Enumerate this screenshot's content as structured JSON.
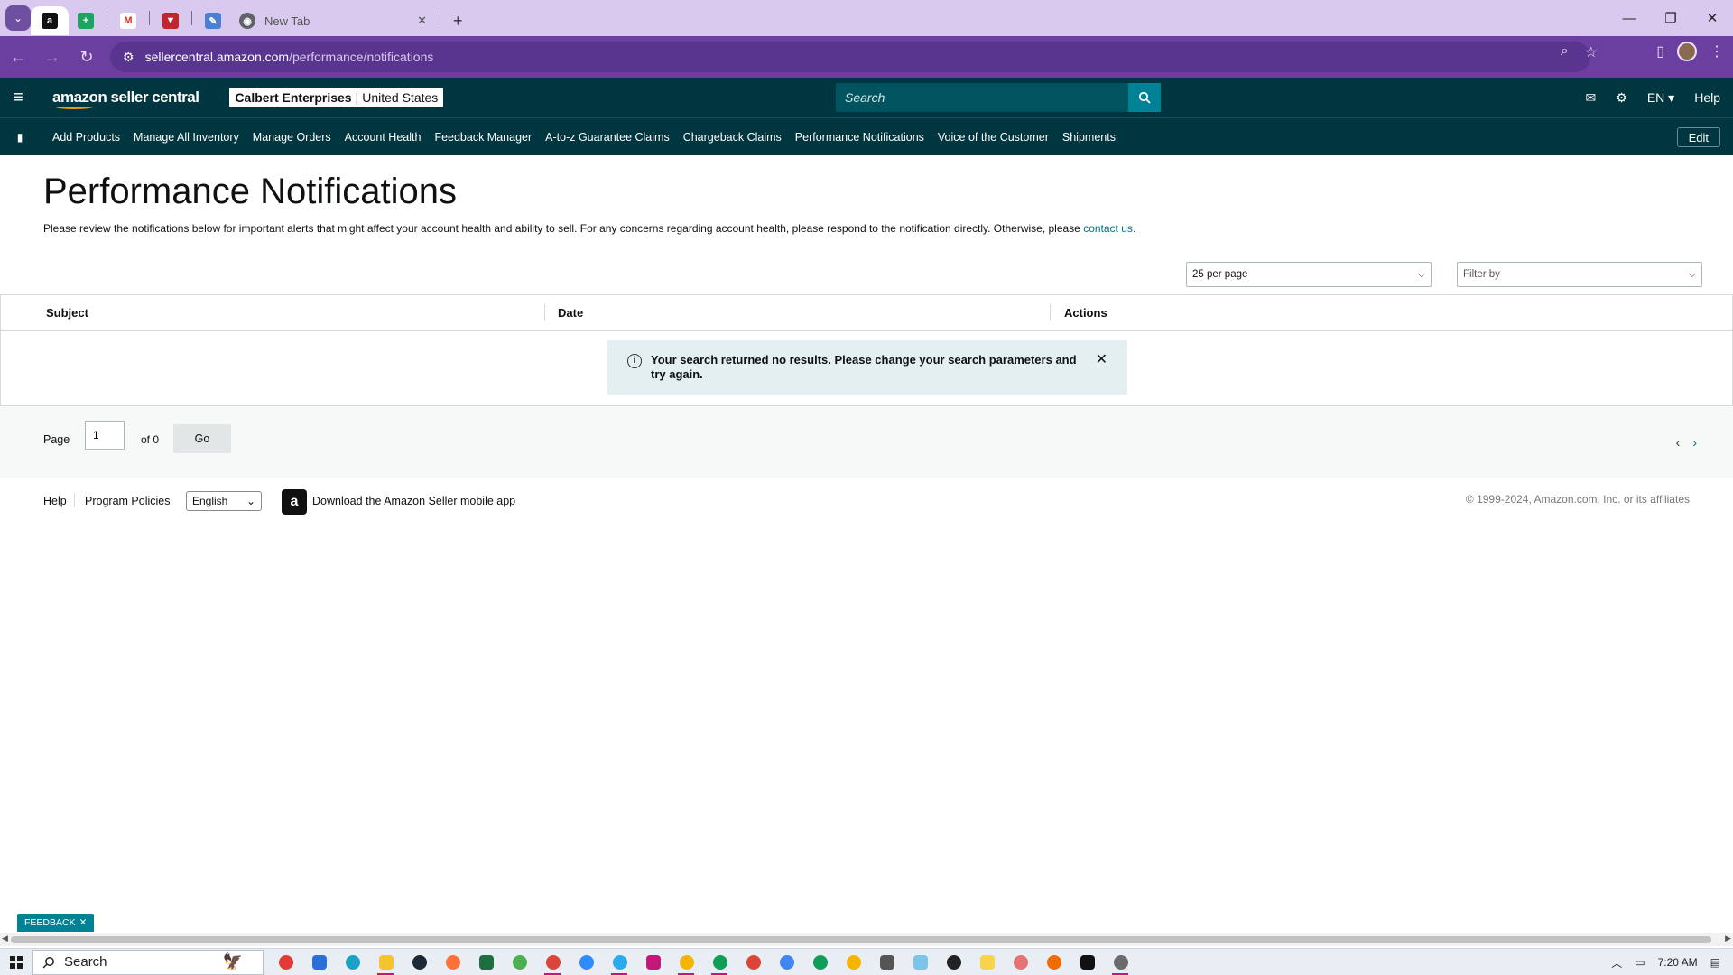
{
  "browser": {
    "tabs": [
      {
        "favicon": "amazon-icon",
        "label": "a",
        "active": true
      },
      {
        "favicon": "sheets-icon"
      },
      {
        "favicon": "gmail-icon"
      },
      {
        "favicon": "brand-icon"
      },
      {
        "favicon": "pen-icon"
      },
      {
        "favicon": "chrome-icon",
        "label": "New Tab"
      }
    ],
    "url_host": "sellercentral.amazon.com",
    "url_path": "/performance/notifications"
  },
  "header": {
    "logo_text": "amazon seller central",
    "account_name": "Calbert Enterprises",
    "marketplace": "United States",
    "search_placeholder": "Search",
    "language": "EN",
    "help": "Help"
  },
  "nav": {
    "items": [
      "Add Products",
      "Manage All Inventory",
      "Manage Orders",
      "Account Health",
      "Feedback Manager",
      "A-to-z Guarantee Claims",
      "Chargeback Claims",
      "Performance Notifications",
      "Voice of the Customer",
      "Shipments"
    ],
    "edit": "Edit"
  },
  "main": {
    "title": "Performance Notifications",
    "intro": "Please review the notifications below for important alerts that might affect your account health and ability to sell. For any concerns regarding account health, please respond to the notification directly. Otherwise, please",
    "intro_link": "contact us.",
    "per_page": "25 per page",
    "filter_placeholder": "Filter by",
    "columns": [
      "Subject",
      "Date",
      "Actions"
    ],
    "alert": "Your search returned no results. Please change your search parameters and try again."
  },
  "pager": {
    "page_label": "Page",
    "page_value": "1",
    "of_label": "of 0",
    "go": "Go"
  },
  "footer": {
    "help": "Help",
    "policies": "Program Policies",
    "language": "English",
    "app_link": "Download the Amazon Seller mobile app",
    "copyright": "© 1999-2024, Amazon.com, Inc. or its affiliates"
  },
  "feedback": "FEEDBACK",
  "taskbar": {
    "search": "Search",
    "time": "7:20 AM"
  },
  "colors": {
    "header_bg": "#00363f",
    "accent": "#008296",
    "link": "#007185",
    "browser_frame": "#6b3fa0"
  }
}
